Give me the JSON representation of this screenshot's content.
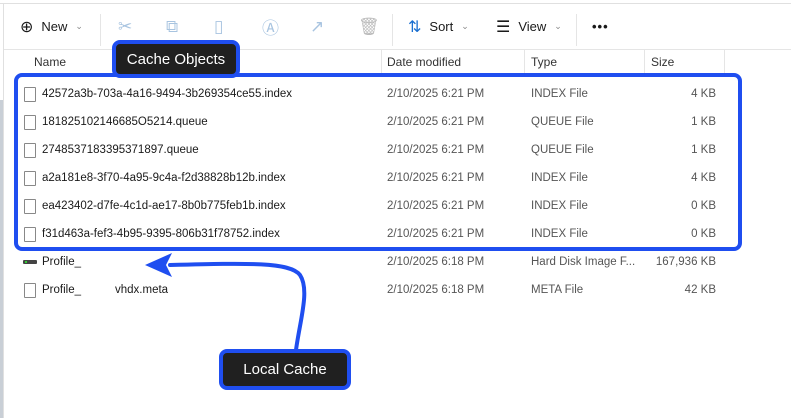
{
  "toolbar": {
    "new_label": "New",
    "sort_label": "Sort",
    "view_label": "View",
    "more_label": "•••",
    "icons": [
      "plus-circle-icon",
      "cut-icon",
      "copy-icon",
      "paste-icon",
      "rename-icon",
      "share-icon",
      "delete-icon",
      "sort-icon",
      "view-icon"
    ]
  },
  "columns": {
    "name": "Name",
    "date": "Date modified",
    "type": "Type",
    "size": "Size"
  },
  "files": [
    {
      "name": "42572a3b-703a-4a16-9494-3b269354ce55.index",
      "date": "2/10/2025 6:21 PM",
      "type": "INDEX File",
      "size": "4 KB",
      "icon": "file"
    },
    {
      "name": "181825102146685O5214.queue",
      "date": "2/10/2025 6:21 PM",
      "type": "QUEUE File",
      "size": "1 KB",
      "icon": "file"
    },
    {
      "name": "2748537183395371897.queue",
      "date": "2/10/2025 6:21 PM",
      "type": "QUEUE File",
      "size": "1 KB",
      "icon": "file"
    },
    {
      "name": "a2a181e8-3f70-4a95-9c4a-f2d38828b12b.index",
      "date": "2/10/2025 6:21 PM",
      "type": "INDEX File",
      "size": "4 KB",
      "icon": "file"
    },
    {
      "name": "ea423402-d7fe-4c1d-ae17-8b0b775feb1b.index",
      "date": "2/10/2025 6:21 PM",
      "type": "INDEX File",
      "size": "0 KB",
      "icon": "file"
    },
    {
      "name": "f31d463a-fef3-4b95-9395-806b31f78752.index",
      "date": "2/10/2025 6:21 PM",
      "type": "INDEX File",
      "size": "0 KB",
      "icon": "file"
    },
    {
      "name": "Profile_",
      "date": "2/10/2025 6:18 PM",
      "type": "Hard Disk Image F...",
      "size": "167,936 KB",
      "icon": "disk"
    },
    {
      "name": "Profile_",
      "name_suffix": "vhdx.meta",
      "date": "2/10/2025 6:18 PM",
      "type": "META File",
      "size": "42 KB",
      "icon": "file"
    }
  ],
  "annotations": {
    "cache_objects": "Cache Objects",
    "local_cache": "Local Cache",
    "accent_color": "#1f4ef0"
  }
}
